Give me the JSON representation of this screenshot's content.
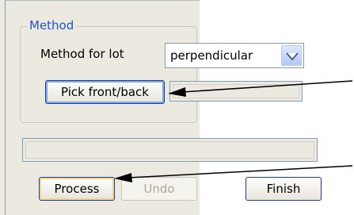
{
  "group": {
    "legend": "Method"
  },
  "method": {
    "label": "Method for lot",
    "selected": "perpendicular",
    "dropdown_icon": "chevron-down-icon"
  },
  "buttons": {
    "pick_label": "Pick front/back",
    "process_label": "Process",
    "undo_label": "Undo",
    "finish_label": "Finish"
  },
  "colors": {
    "panel_bg": "#eceae0",
    "accent": "#2155cd",
    "field_border": "#7f9db9",
    "disabled_text": "#aca899"
  },
  "annotations": {
    "arrow_icon": "arrow-left-icon"
  }
}
